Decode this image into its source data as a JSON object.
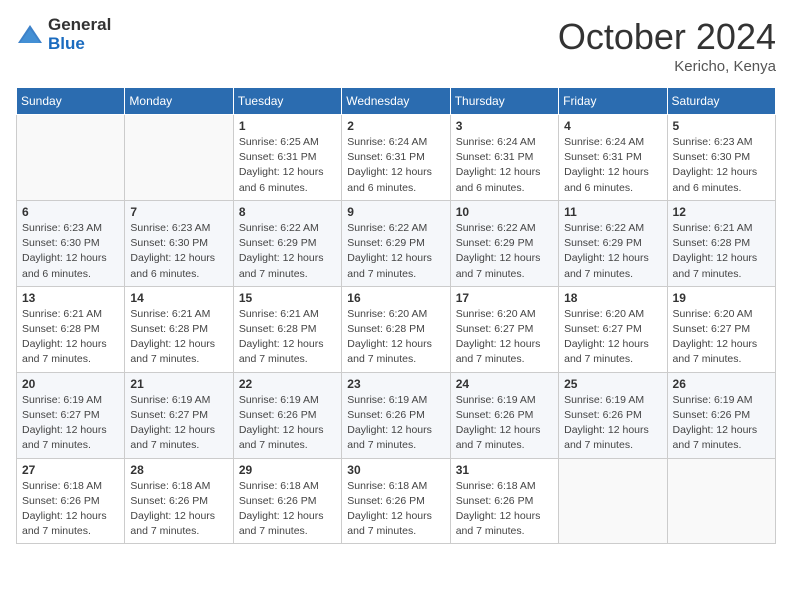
{
  "logo": {
    "general": "General",
    "blue": "Blue"
  },
  "title": {
    "month_year": "October 2024",
    "location": "Kericho, Kenya"
  },
  "weekdays": [
    "Sunday",
    "Monday",
    "Tuesday",
    "Wednesday",
    "Thursday",
    "Friday",
    "Saturday"
  ],
  "weeks": [
    [
      {
        "day": "",
        "info": ""
      },
      {
        "day": "",
        "info": ""
      },
      {
        "day": "1",
        "info": "Sunrise: 6:25 AM\nSunset: 6:31 PM\nDaylight: 12 hours and 6 minutes."
      },
      {
        "day": "2",
        "info": "Sunrise: 6:24 AM\nSunset: 6:31 PM\nDaylight: 12 hours and 6 minutes."
      },
      {
        "day": "3",
        "info": "Sunrise: 6:24 AM\nSunset: 6:31 PM\nDaylight: 12 hours and 6 minutes."
      },
      {
        "day": "4",
        "info": "Sunrise: 6:24 AM\nSunset: 6:31 PM\nDaylight: 12 hours and 6 minutes."
      },
      {
        "day": "5",
        "info": "Sunrise: 6:23 AM\nSunset: 6:30 PM\nDaylight: 12 hours and 6 minutes."
      }
    ],
    [
      {
        "day": "6",
        "info": "Sunrise: 6:23 AM\nSunset: 6:30 PM\nDaylight: 12 hours and 6 minutes."
      },
      {
        "day": "7",
        "info": "Sunrise: 6:23 AM\nSunset: 6:30 PM\nDaylight: 12 hours and 6 minutes."
      },
      {
        "day": "8",
        "info": "Sunrise: 6:22 AM\nSunset: 6:29 PM\nDaylight: 12 hours and 7 minutes."
      },
      {
        "day": "9",
        "info": "Sunrise: 6:22 AM\nSunset: 6:29 PM\nDaylight: 12 hours and 7 minutes."
      },
      {
        "day": "10",
        "info": "Sunrise: 6:22 AM\nSunset: 6:29 PM\nDaylight: 12 hours and 7 minutes."
      },
      {
        "day": "11",
        "info": "Sunrise: 6:22 AM\nSunset: 6:29 PM\nDaylight: 12 hours and 7 minutes."
      },
      {
        "day": "12",
        "info": "Sunrise: 6:21 AM\nSunset: 6:28 PM\nDaylight: 12 hours and 7 minutes."
      }
    ],
    [
      {
        "day": "13",
        "info": "Sunrise: 6:21 AM\nSunset: 6:28 PM\nDaylight: 12 hours and 7 minutes."
      },
      {
        "day": "14",
        "info": "Sunrise: 6:21 AM\nSunset: 6:28 PM\nDaylight: 12 hours and 7 minutes."
      },
      {
        "day": "15",
        "info": "Sunrise: 6:21 AM\nSunset: 6:28 PM\nDaylight: 12 hours and 7 minutes."
      },
      {
        "day": "16",
        "info": "Sunrise: 6:20 AM\nSunset: 6:28 PM\nDaylight: 12 hours and 7 minutes."
      },
      {
        "day": "17",
        "info": "Sunrise: 6:20 AM\nSunset: 6:27 PM\nDaylight: 12 hours and 7 minutes."
      },
      {
        "day": "18",
        "info": "Sunrise: 6:20 AM\nSunset: 6:27 PM\nDaylight: 12 hours and 7 minutes."
      },
      {
        "day": "19",
        "info": "Sunrise: 6:20 AM\nSunset: 6:27 PM\nDaylight: 12 hours and 7 minutes."
      }
    ],
    [
      {
        "day": "20",
        "info": "Sunrise: 6:19 AM\nSunset: 6:27 PM\nDaylight: 12 hours and 7 minutes."
      },
      {
        "day": "21",
        "info": "Sunrise: 6:19 AM\nSunset: 6:27 PM\nDaylight: 12 hours and 7 minutes."
      },
      {
        "day": "22",
        "info": "Sunrise: 6:19 AM\nSunset: 6:26 PM\nDaylight: 12 hours and 7 minutes."
      },
      {
        "day": "23",
        "info": "Sunrise: 6:19 AM\nSunset: 6:26 PM\nDaylight: 12 hours and 7 minutes."
      },
      {
        "day": "24",
        "info": "Sunrise: 6:19 AM\nSunset: 6:26 PM\nDaylight: 12 hours and 7 minutes."
      },
      {
        "day": "25",
        "info": "Sunrise: 6:19 AM\nSunset: 6:26 PM\nDaylight: 12 hours and 7 minutes."
      },
      {
        "day": "26",
        "info": "Sunrise: 6:19 AM\nSunset: 6:26 PM\nDaylight: 12 hours and 7 minutes."
      }
    ],
    [
      {
        "day": "27",
        "info": "Sunrise: 6:18 AM\nSunset: 6:26 PM\nDaylight: 12 hours and 7 minutes."
      },
      {
        "day": "28",
        "info": "Sunrise: 6:18 AM\nSunset: 6:26 PM\nDaylight: 12 hours and 7 minutes."
      },
      {
        "day": "29",
        "info": "Sunrise: 6:18 AM\nSunset: 6:26 PM\nDaylight: 12 hours and 7 minutes."
      },
      {
        "day": "30",
        "info": "Sunrise: 6:18 AM\nSunset: 6:26 PM\nDaylight: 12 hours and 7 minutes."
      },
      {
        "day": "31",
        "info": "Sunrise: 6:18 AM\nSunset: 6:26 PM\nDaylight: 12 hours and 7 minutes."
      },
      {
        "day": "",
        "info": ""
      },
      {
        "day": "",
        "info": ""
      }
    ]
  ]
}
